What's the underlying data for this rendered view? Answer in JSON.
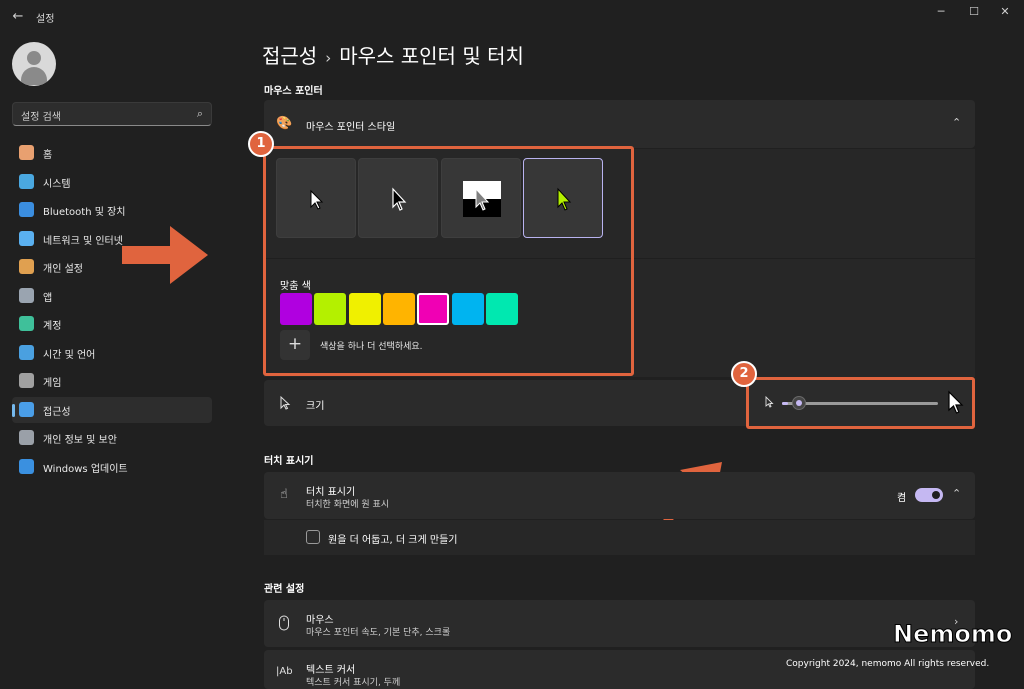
{
  "window": {
    "title": "설정",
    "back_icon": "back-arrow-icon",
    "minimize": "─",
    "maximize": "☐",
    "close": "✕"
  },
  "sidebar": {
    "search_placeholder": "설정 검색",
    "items": [
      {
        "label": "홈",
        "icon": "home-icon",
        "color": "#e8a070"
      },
      {
        "label": "시스템",
        "icon": "system-icon",
        "color": "#4aa8e0"
      },
      {
        "label": "Bluetooth 및 장치",
        "icon": "bluetooth-icon",
        "color": "#3b8ee0"
      },
      {
        "label": "네트워크 및 인터넷",
        "icon": "wifi-icon",
        "color": "#5ab0f0"
      },
      {
        "label": "개인 설정",
        "icon": "brush-icon",
        "color": "#e0a050"
      },
      {
        "label": "앱",
        "icon": "apps-icon",
        "color": "#9aa4b0"
      },
      {
        "label": "계정",
        "icon": "account-icon",
        "color": "#3fc09a"
      },
      {
        "label": "시간 및 언어",
        "icon": "globe-clock-icon",
        "color": "#4aa0e0"
      },
      {
        "label": "게임",
        "icon": "gamepad-icon",
        "color": "#a0a0a0"
      },
      {
        "label": "접근성",
        "icon": "accessibility-icon",
        "color": "#4a9ee8"
      },
      {
        "label": "개인 정보 및 보안",
        "icon": "shield-icon",
        "color": "#9aa0a8"
      },
      {
        "label": "Windows 업데이트",
        "icon": "update-icon",
        "color": "#3a90e0"
      }
    ],
    "active_index": 9
  },
  "main": {
    "breadcrumb_parent": "접근성",
    "breadcrumb_sep": "›",
    "breadcrumb_current": "마우스 포인터 및 터치",
    "section_pointer": "마우스 포인터",
    "pointer_style_label": "마우스 포인터 스타일",
    "custom_color_label": "맞춤 색",
    "add_color_label": "색상을 하나 더 선택하세요.",
    "swatches": [
      "#b000e0",
      "#b4f000",
      "#f0f000",
      "#ffb400",
      "#f000b4",
      "#00b4f0",
      "#00e8b0"
    ],
    "selected_swatch": 4,
    "size_label": "크기",
    "size_value": 0.04,
    "section_touch": "터치 표시기",
    "touch_label": "터치 표시기",
    "touch_sub": "터치한 화면에 원 표시",
    "touch_state": "켬",
    "touch_checkbox_label": "원을 더 어둡고, 더 크게 만들기",
    "section_related": "관련 설정",
    "mouse_label": "마우스",
    "mouse_sub": "마우스 포인터 속도, 기본 단추, 스크롤",
    "text_cursor_label": "텍스트 커서",
    "text_cursor_sub": "텍스트 커서 표시기, 두께"
  },
  "annotations": {
    "badge1": "1",
    "badge2": "2",
    "accent": "#e0643e"
  },
  "watermark": {
    "brand": "Nemomo",
    "copyright": "Copyright 2024, nemomo All rights reserved."
  }
}
